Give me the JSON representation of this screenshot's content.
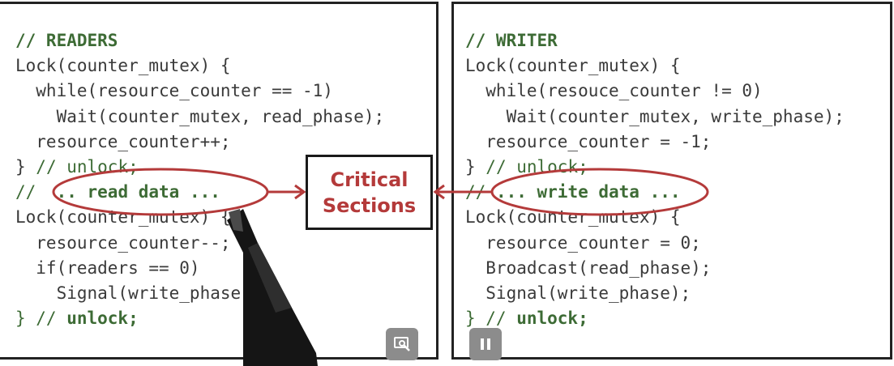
{
  "readers": {
    "header": "// READERS",
    "l1": "Lock(counter_mutex) {",
    "l2": "  while(resource_counter == -1)",
    "l3": "    Wait(counter_mutex, read_phase);",
    "l4": "  resource_counter++;",
    "l5a": "} ",
    "l5b": "// unlock;",
    "l6a": "// ",
    "l6b": " .. read data ...",
    "l7": "Lock(counter_mutex) {",
    "l8": "  resource_counter--;",
    "l9": "  if(readers == 0)",
    "l10": "    Signal(write_phase);",
    "l11a": "} // ",
    "l11b": "unlock;"
  },
  "writer": {
    "header": "// WRITER",
    "l1": "Lock(counter_mutex) {",
    "l2": "  while(resouce_counter != 0)",
    "l3": "    Wait(counter_mutex, write_phase);",
    "l4": "  resource_counter = -1;",
    "l5a": "} ",
    "l5b": "// unlock;",
    "l6a": "// ",
    "l6b": "... write data ...",
    "l7": "Lock(counter_mutex) {",
    "l8": "  resource_counter = 0;",
    "l9": "  Broadcast(read_phase);",
    "l10": "  Signal(write_phase);",
    "l11a": "} // ",
    "l11b": "unlock;"
  },
  "critical_sections": {
    "label": "Critical\nSections"
  },
  "colors": {
    "annotation": "#b43a3a",
    "comment": "#3d6b35",
    "code": "#3a3a3a"
  },
  "controls": {
    "zoom_icon": "zoom-icon",
    "pause_icon": "pause-icon"
  }
}
